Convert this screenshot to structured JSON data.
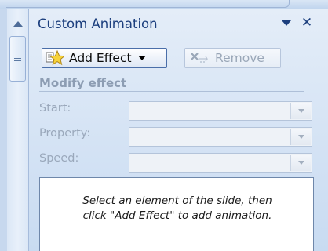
{
  "pane": {
    "title": "Custom Animation",
    "add_effect_label": "Add Effect",
    "remove_label": "Remove",
    "modify_section": "Modify effect",
    "fields": [
      {
        "label": "Start:",
        "value": ""
      },
      {
        "label": "Property:",
        "value": ""
      },
      {
        "label": "Speed:",
        "value": ""
      }
    ],
    "hint_line1": "Select an element of the slide, then",
    "hint_line2": "click \"Add Effect\" to add animation."
  },
  "icons": {
    "pane_menu": "chevron-down-icon",
    "pane_close": "close-icon",
    "add_effect": "star-icon",
    "remove": "remove-x-icon"
  },
  "colors": {
    "title": "#1c3f7e",
    "pane_background": "#d3e2f4",
    "disabled_text": "#9aa8bb"
  }
}
